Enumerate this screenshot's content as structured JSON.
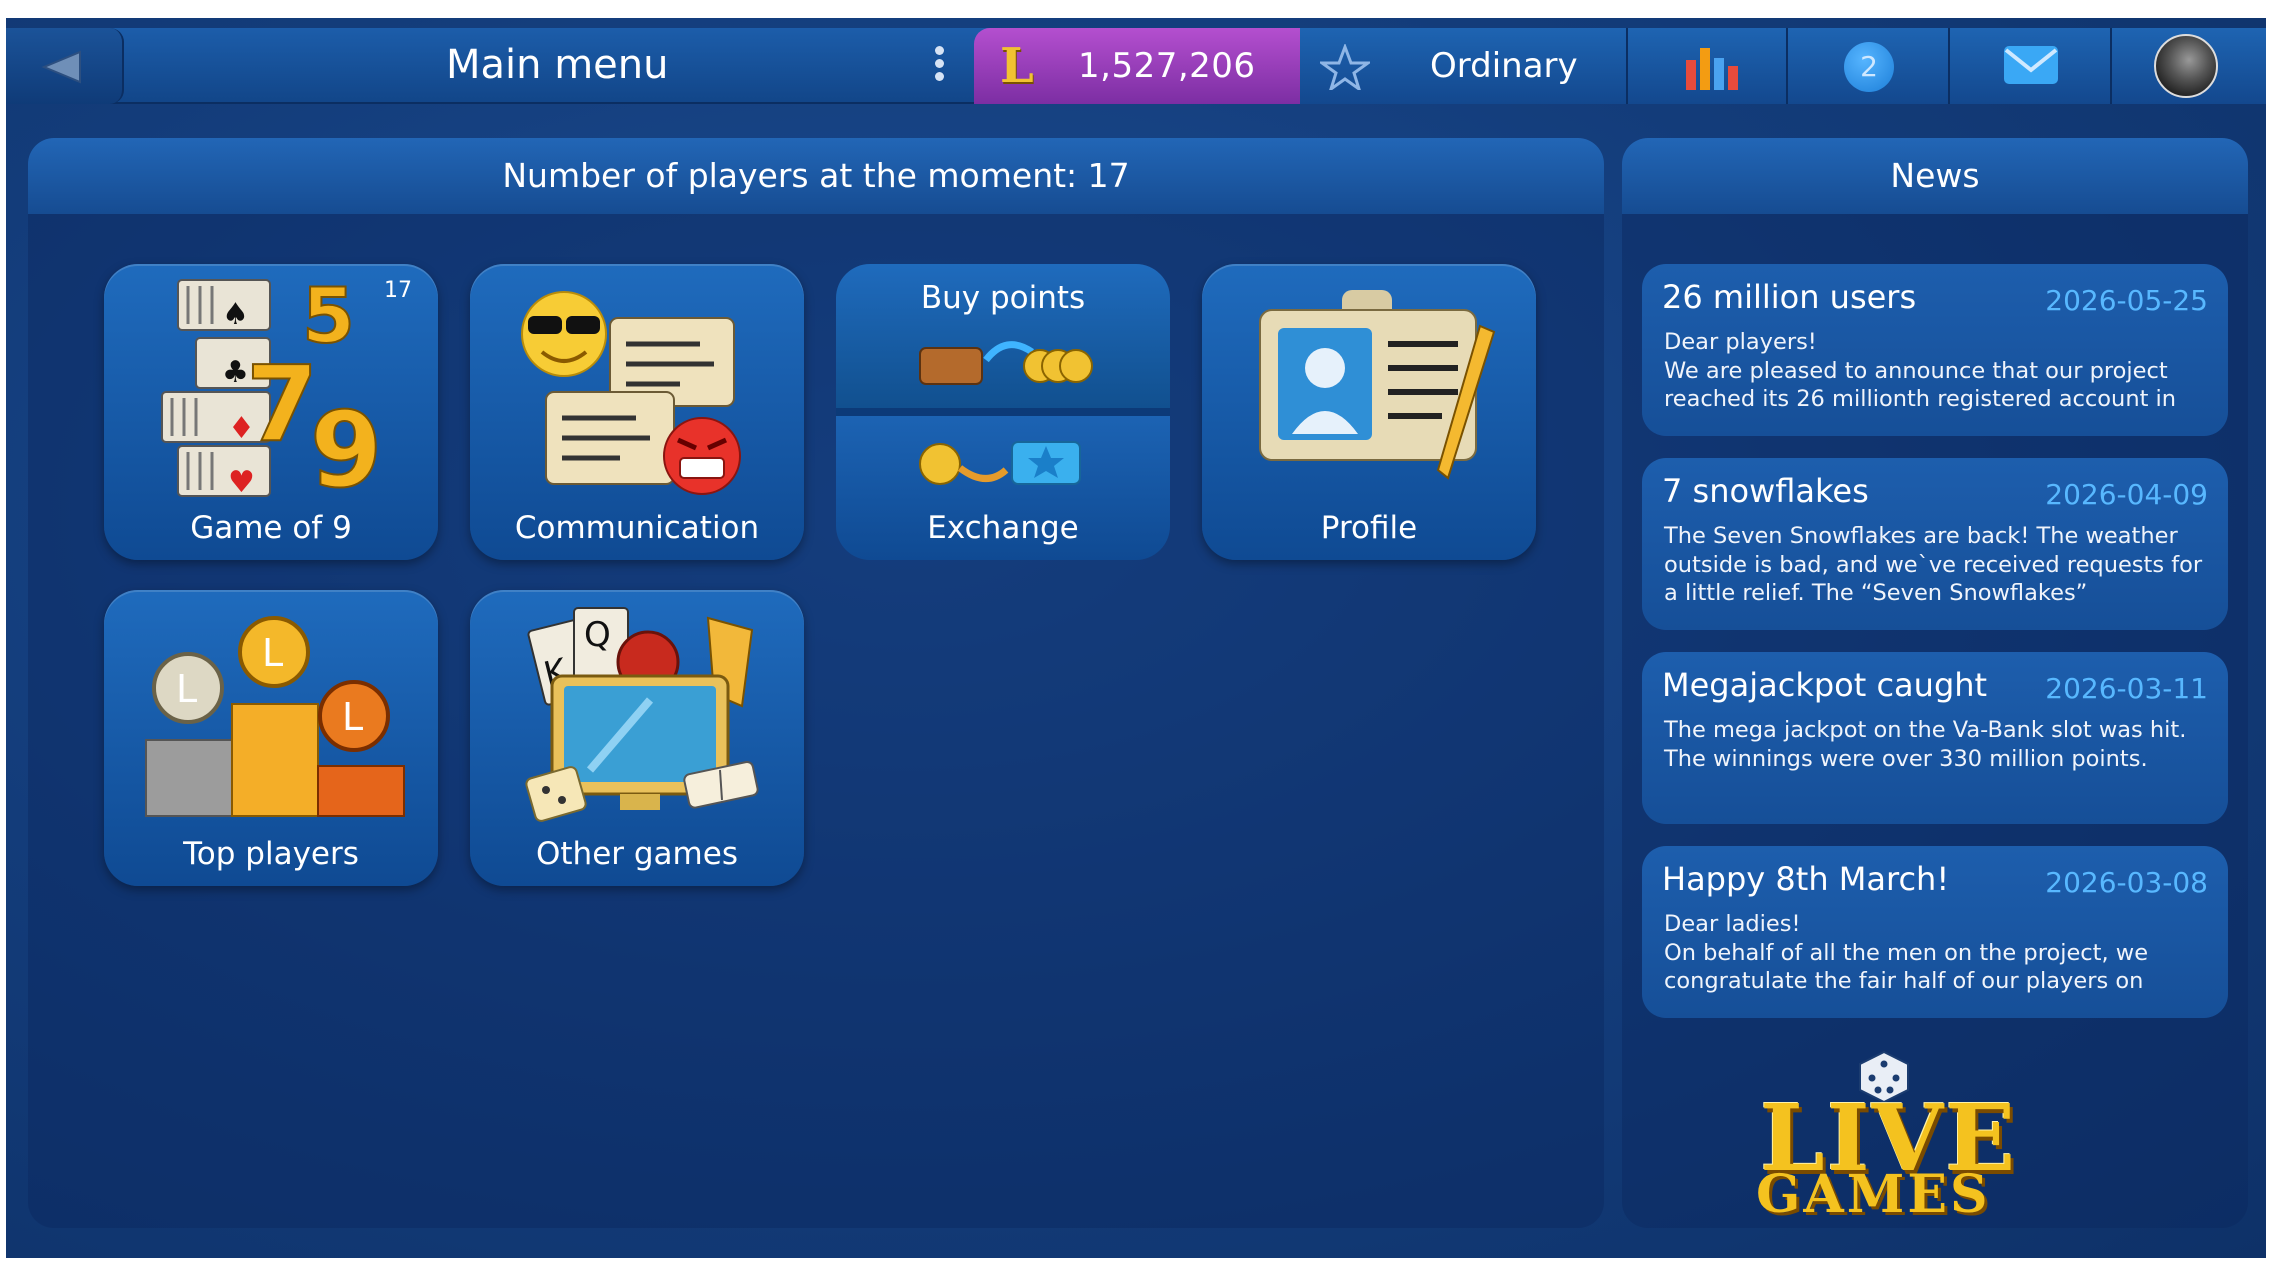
{
  "topbar": {
    "title": "Main menu",
    "balance": "1,527,206",
    "rank": "Ordinary",
    "notifications": "2"
  },
  "main": {
    "header": "Number of players at the moment: 17",
    "tiles": {
      "game9": {
        "label": "Game of 9",
        "count": "17"
      },
      "communication": {
        "label": "Communication"
      },
      "buy": {
        "label": "Buy points"
      },
      "exchange": {
        "label": "Exchange"
      },
      "profile": {
        "label": "Profile"
      },
      "top": {
        "label": "Top players"
      },
      "other": {
        "label": "Other games"
      }
    }
  },
  "news": {
    "header": "News",
    "items": [
      {
        "title": "26 million users",
        "date": "2026-05-25",
        "body": "Dear players!\nWe are pleased to announce that our project reached its 26 millionth registered account in"
      },
      {
        "title": "7 snowflakes",
        "date": "2026-04-09",
        "body": "The Seven Snowflakes are back! The weather outside is bad, and we`ve received requests for a little relief. The “Seven Snowflakes”"
      },
      {
        "title": "Megajackpot caught",
        "date": "2026-03-11",
        "body": "The mega jackpot on the Va-Bank slot was hit. The winnings were over 330 million points."
      },
      {
        "title": "Happy 8th March!",
        "date": "2026-03-08",
        "body": "Dear ladies!\nOn behalf of all the men on the project, we congratulate the fair half of our players on"
      }
    ]
  },
  "logo": {
    "line1": "LIVE",
    "line2": "GAMES"
  },
  "colors": {
    "accent_purple": "#9b3fc0",
    "news_date": "#58b8ff",
    "gold": "#f4c21f",
    "background": "#133c7a"
  },
  "icons": [
    "back-arrow-icon",
    "more-vert-icon",
    "coin-l-icon",
    "star-outline-icon",
    "bar-chart-icon",
    "notification-badge-icon",
    "mail-icon",
    "avatar"
  ]
}
